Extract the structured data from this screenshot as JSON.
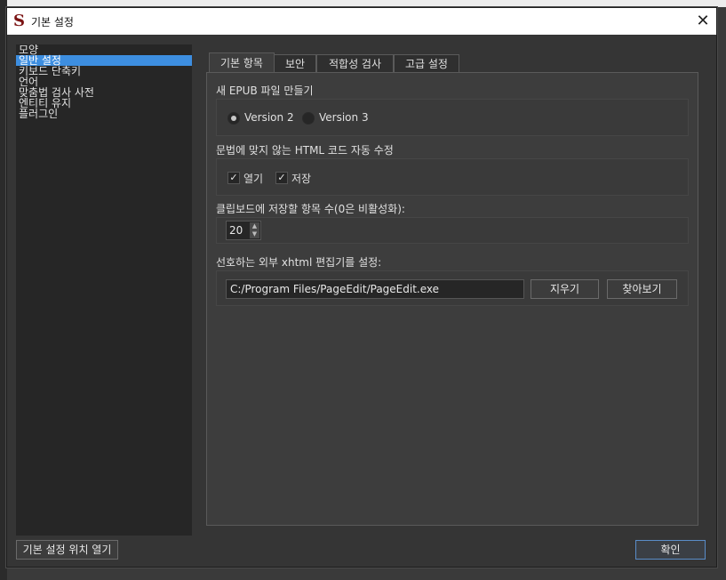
{
  "window": {
    "title": "기본 설정",
    "app_icon_glyph": "S",
    "close_glyph": "✕"
  },
  "sidebar": {
    "items": [
      {
        "label": "모양"
      },
      {
        "label": "일반 설정",
        "selected": true
      },
      {
        "label": "키보드 단축키"
      },
      {
        "label": "언어"
      },
      {
        "label": "맞춤법 검사 사전"
      },
      {
        "label": "엔티티 유지"
      },
      {
        "label": "플러그인"
      }
    ]
  },
  "tabs": [
    {
      "label": "기본 항목",
      "active": true
    },
    {
      "label": "보안"
    },
    {
      "label": "적합성 검사"
    },
    {
      "label": "고급 설정"
    }
  ],
  "epub": {
    "label": "새 EPUB 파일 만들기",
    "options": [
      {
        "label": "Version 2",
        "selected": true
      },
      {
        "label": "Version 3",
        "selected": false
      }
    ]
  },
  "html_fix": {
    "label": "문법에 맞지 않는 HTML 코드 자동 수정",
    "options": [
      {
        "label": "열기",
        "checked": true
      },
      {
        "label": "저장",
        "checked": true
      }
    ]
  },
  "clipboard": {
    "label": "클립보드에 저장할 항목 수(0은 비활성화):",
    "value": "20"
  },
  "xhtml_editor": {
    "label": "선호하는 외부 xhtml 편집기를 설정:",
    "path": "C:/Program Files/PageEdit/PageEdit.exe",
    "clear_label": "지우기",
    "browse_label": "찾아보기"
  },
  "footer": {
    "open_location_label": "기본 설정 위치 열기",
    "ok_label": "확인"
  },
  "colors": {
    "selection": "#3d8ee0",
    "dialog_bg": "#353535",
    "panel_bg": "#3d3d3d"
  }
}
